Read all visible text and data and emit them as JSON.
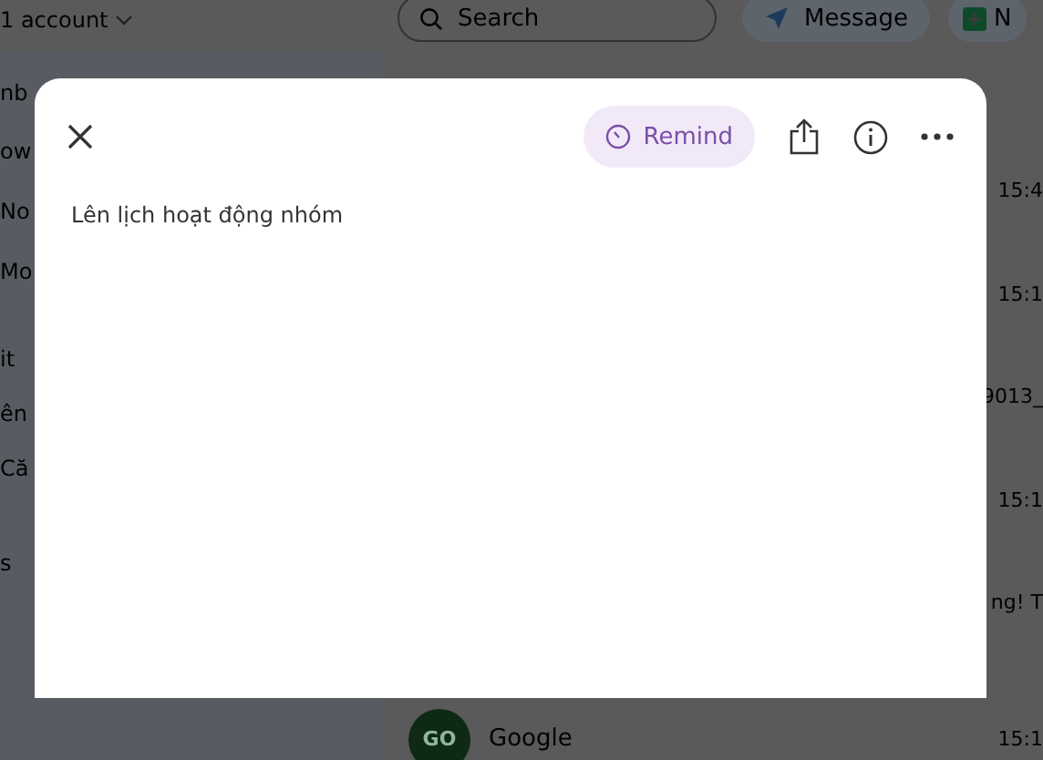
{
  "top_bar": {
    "account": "1 account",
    "search": {
      "placeholder": "Search"
    },
    "message_button": "Message",
    "new_button": "N"
  },
  "sidebar": {
    "items": [
      {
        "label": "nb"
      },
      {
        "label": "ow"
      },
      {
        "label": "No"
      },
      {
        "label": "Mo"
      },
      {
        "label": "it"
      },
      {
        "label": "ên"
      },
      {
        "label": "Că"
      },
      {
        "label": "s"
      }
    ]
  },
  "list": {
    "rows": [
      {
        "text": "15:4"
      },
      {
        "text": "15:1"
      },
      {
        "text": "9013_"
      },
      {
        "text": "15:1"
      },
      {
        "text": "ng! T"
      }
    ],
    "last_row": {
      "avatar": "GO",
      "name": "Google",
      "time": "15:1"
    }
  },
  "modal": {
    "remind_button": "Remind",
    "body": "Lên lịch hoạt động nhóm"
  }
}
